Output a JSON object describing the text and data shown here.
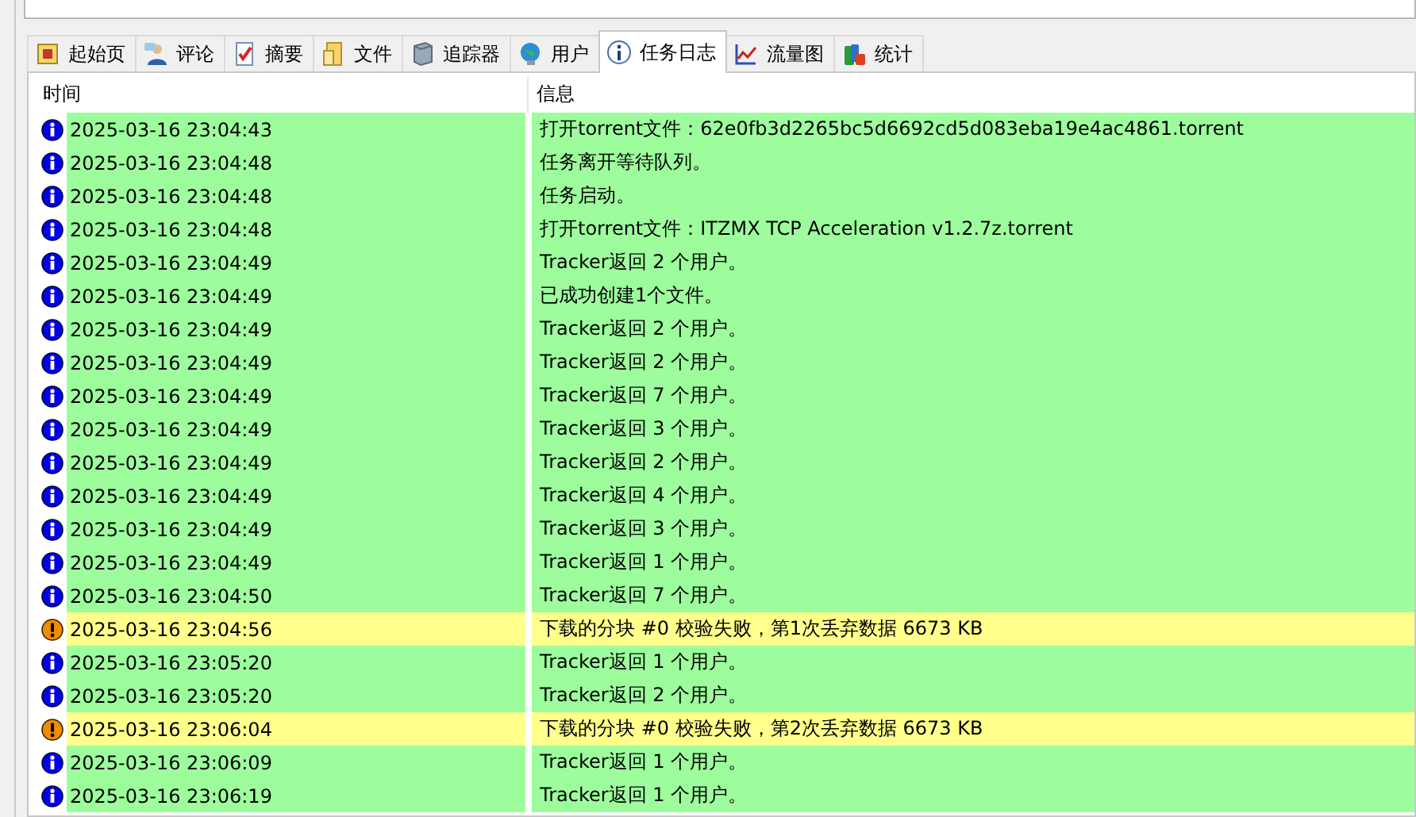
{
  "tabs": [
    {
      "label": "起始页",
      "selected": false
    },
    {
      "label": "评论",
      "selected": false
    },
    {
      "label": "摘要",
      "selected": false
    },
    {
      "label": "文件",
      "selected": false
    },
    {
      "label": "追踪器",
      "selected": false
    },
    {
      "label": "用户",
      "selected": false
    },
    {
      "label": "任务日志",
      "selected": true
    },
    {
      "label": "流量图",
      "selected": false
    },
    {
      "label": "统计",
      "selected": false
    }
  ],
  "log": {
    "columns": [
      "时间",
      "信息"
    ],
    "rows": [
      {
        "kind": "info",
        "time": "2025-03-16 23:04:43",
        "message": "打开torrent文件：62e0fb3d2265bc5d6692cd5d083eba19e4ac4861.torrent"
      },
      {
        "kind": "info",
        "time": "2025-03-16 23:04:48",
        "message": "任务离开等待队列。"
      },
      {
        "kind": "info",
        "time": "2025-03-16 23:04:48",
        "message": "任务启动。"
      },
      {
        "kind": "info",
        "time": "2025-03-16 23:04:48",
        "message": "打开torrent文件：ITZMX TCP Acceleration v1.2.7z.torrent"
      },
      {
        "kind": "info",
        "time": "2025-03-16 23:04:49",
        "message": "Tracker返回 2 个用户。"
      },
      {
        "kind": "info",
        "time": "2025-03-16 23:04:49",
        "message": "已成功创建1个文件。"
      },
      {
        "kind": "info",
        "time": "2025-03-16 23:04:49",
        "message": "Tracker返回 2 个用户。"
      },
      {
        "kind": "info",
        "time": "2025-03-16 23:04:49",
        "message": "Tracker返回 2 个用户。"
      },
      {
        "kind": "info",
        "time": "2025-03-16 23:04:49",
        "message": "Tracker返回 7 个用户。"
      },
      {
        "kind": "info",
        "time": "2025-03-16 23:04:49",
        "message": "Tracker返回 3 个用户。"
      },
      {
        "kind": "info",
        "time": "2025-03-16 23:04:49",
        "message": "Tracker返回 2 个用户。"
      },
      {
        "kind": "info",
        "time": "2025-03-16 23:04:49",
        "message": "Tracker返回 4 个用户。"
      },
      {
        "kind": "info",
        "time": "2025-03-16 23:04:49",
        "message": "Tracker返回 3 个用户。"
      },
      {
        "kind": "info",
        "time": "2025-03-16 23:04:49",
        "message": "Tracker返回 1 个用户。"
      },
      {
        "kind": "info",
        "time": "2025-03-16 23:04:50",
        "message": "Tracker返回 7 个用户。"
      },
      {
        "kind": "warning",
        "time": "2025-03-16 23:04:56",
        "message": "下载的分块 #0 校验失败，第1次丢弃数据 6673 KB"
      },
      {
        "kind": "info",
        "time": "2025-03-16 23:05:20",
        "message": "Tracker返回 1 个用户。"
      },
      {
        "kind": "info",
        "time": "2025-03-16 23:05:20",
        "message": "Tracker返回 2 个用户。"
      },
      {
        "kind": "warning",
        "time": "2025-03-16 23:06:04",
        "message": "下载的分块 #0 校验失败，第2次丢弃数据 6673 KB"
      },
      {
        "kind": "info",
        "time": "2025-03-16 23:06:09",
        "message": "Tracker返回 1 个用户。"
      },
      {
        "kind": "info",
        "time": "2025-03-16 23:06:19",
        "message": "Tracker返回 1 个用户。"
      }
    ]
  }
}
